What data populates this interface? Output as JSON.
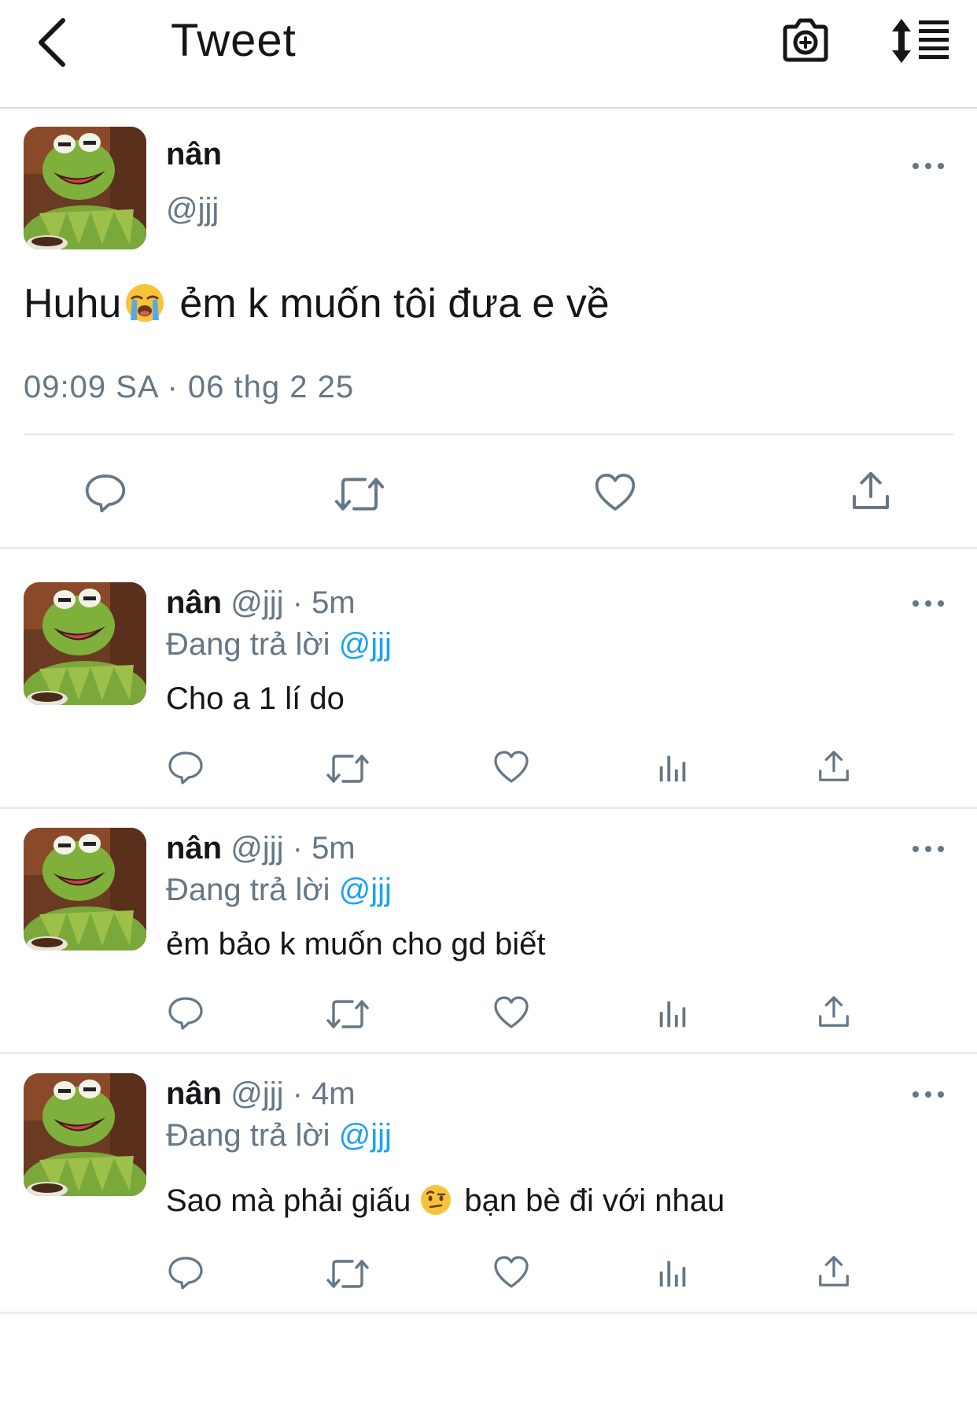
{
  "header": {
    "title": "Tweet",
    "back_icon": "chevron-left-icon",
    "camera_icon": "camera-plus-icon",
    "sort_icon": "sort-list-icon"
  },
  "main_tweet": {
    "name": "nân",
    "handle": "@jjj",
    "text_before": "Huhu",
    "emoji": "loudly-crying-face",
    "text_after": "ẻm k muốn tôi đưa e về",
    "timestamp": "09:09 SA · 06 thg 2 25",
    "actions": [
      "reply-icon",
      "retweet-icon",
      "like-icon",
      "share-icon"
    ]
  },
  "replies": [
    {
      "name": "nân",
      "meta": "@jjj · 5m",
      "replying_label": "Đang trả lời",
      "replying_to": "@jjj",
      "text": "Cho a 1 lí do"
    },
    {
      "name": "nân",
      "meta": "@jjj · 5m",
      "replying_label": "Đang trả lời",
      "replying_to": "@jjj",
      "text": "ẻm bảo k muốn cho gd biết"
    },
    {
      "name": "nân",
      "meta": "@jjj · 4m",
      "replying_label": "Đang trả lời",
      "replying_to": "@jjj",
      "text_before": "Sao mà phải giấu",
      "emoji": "face-with-raised-eyebrow",
      "text_after": "bạn bè đi với nhau"
    }
  ],
  "colors": {
    "text": "#14171a",
    "secondary": "#657786",
    "link": "#1da1f2",
    "divider": "#e1e5e8"
  }
}
